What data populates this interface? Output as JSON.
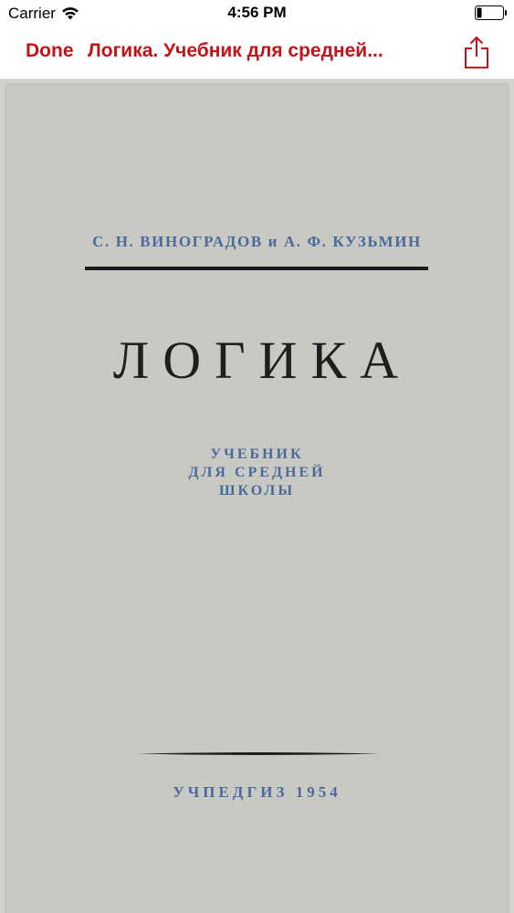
{
  "status_bar": {
    "carrier": "Carrier",
    "time": "4:56 PM",
    "wifi_icon": "wifi-icon",
    "battery_icon": "battery-icon"
  },
  "nav_bar": {
    "done_label": "Done",
    "title": "Логика. Учебник для средней...",
    "share_icon": "share-icon",
    "accent_color": "#c1131a"
  },
  "cover": {
    "authors": "С. Н. ВИНОГРАДОВ и А. Ф. КУЗЬМИН",
    "title": "ЛОГИКА",
    "subtitle_lines": [
      "УЧЕБНИК",
      "ДЛЯ СРЕДНЕЙ",
      "ШКОЛЫ"
    ],
    "publisher": "УЧПЕДГИЗ 1954",
    "background_color": "#c9c9c4",
    "text_color_blue": "#4a6a9c",
    "text_color_dark": "#1e1e1e"
  }
}
